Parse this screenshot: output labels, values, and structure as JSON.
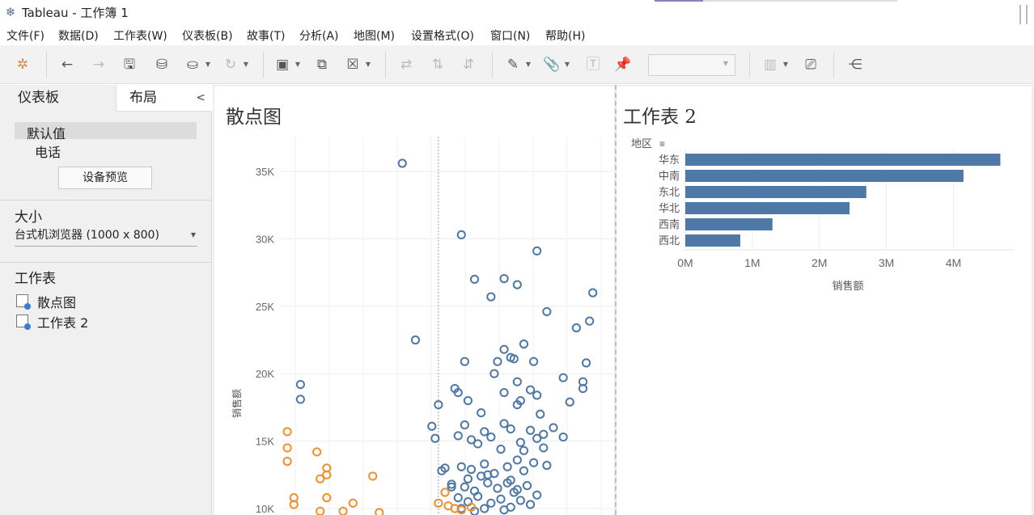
{
  "window": {
    "title": "Tableau - 工作簿 1"
  },
  "menu": [
    "文件(F)",
    "数据(D)",
    "工作表(W)",
    "仪表板(B)",
    "故事(T)",
    "分析(A)",
    "地图(M)",
    "设置格式(O)",
    "窗口(N)",
    "帮助(H)"
  ],
  "toolbar": {
    "icons": [
      "tableau-logo-icon",
      "undo-icon",
      "redo-icon",
      "save-icon",
      "new-datasource-icon",
      "pause-update-icon",
      "refresh-icon",
      "new-sheet-icon",
      "duplicate-sheet-icon",
      "clear-sheet-icon",
      "swap-icon",
      "sort-ascending-icon",
      "sort-descending-icon",
      "highlight-icon",
      "group-icon",
      "label-icon",
      "pin-icon",
      "show-cards-icon",
      "presentation-icon",
      "share-icon"
    ],
    "fit_value": ""
  },
  "left_panel": {
    "tab_dashboard": "仪表板",
    "tab_layout": "布局",
    "devices": [
      "默认值",
      "电话"
    ],
    "device_preview_button": "设备预览",
    "size_header": "大小",
    "size_value": "台式机浏览器 (1000 x 800)",
    "sheets_header": "工作表",
    "sheets": [
      "散点图",
      "工作表 2"
    ]
  },
  "dashboard": {
    "scatter_title": "散点图",
    "bar_title": "工作表 2"
  },
  "colors": {
    "blue": "#4e79a7",
    "orange": "#f28e2b"
  },
  "chart_data": [
    {
      "type": "scatter",
      "title": "散点图",
      "ylabel": "销售额",
      "yticks": [
        "35K",
        "30K",
        "25K",
        "20K",
        "15K",
        "10K"
      ],
      "ylim": [
        9500,
        37000
      ],
      "xlim": [
        0,
        1
      ],
      "reference_line_x": 0.48,
      "series": [
        {
          "name": "",
          "color": "#4e79a7",
          "points": [
            [
              0.37,
              35600
            ],
            [
              0.55,
              30300
            ],
            [
              0.78,
              29100
            ],
            [
              0.59,
              27000
            ],
            [
              0.68,
              27050
            ],
            [
              0.72,
              26600
            ],
            [
              0.64,
              25700
            ],
            [
              0.95,
              26000
            ],
            [
              0.81,
              24600
            ],
            [
              0.9,
              23400
            ],
            [
              0.94,
              23900
            ],
            [
              0.41,
              22500
            ],
            [
              0.74,
              22200
            ],
            [
              0.68,
              21800
            ],
            [
              0.7,
              21200
            ],
            [
              0.56,
              20900
            ],
            [
              0.66,
              20900
            ],
            [
              0.71,
              21100
            ],
            [
              0.77,
              20900
            ],
            [
              0.93,
              20800
            ],
            [
              0.65,
              20000
            ],
            [
              0.86,
              19700
            ],
            [
              0.92,
              19400
            ],
            [
              0.06,
              19200
            ],
            [
              0.53,
              18900
            ],
            [
              0.72,
              19400
            ],
            [
              0.92,
              18900
            ],
            [
              0.68,
              18600
            ],
            [
              0.54,
              18600
            ],
            [
              0.76,
              18800
            ],
            [
              0.78,
              18400
            ],
            [
              0.57,
              18000
            ],
            [
              0.73,
              18000
            ],
            [
              0.72,
              17700
            ],
            [
              0.48,
              17700
            ],
            [
              0.61,
              17100
            ],
            [
              0.88,
              17900
            ],
            [
              0.06,
              18100
            ],
            [
              0.79,
              17000
            ],
            [
              0.46,
              16100
            ],
            [
              0.56,
              16200
            ],
            [
              0.62,
              15700
            ],
            [
              0.68,
              16300
            ],
            [
              0.7,
              15900
            ],
            [
              0.76,
              15800
            ],
            [
              0.8,
              15500
            ],
            [
              0.83,
              16000
            ],
            [
              0.54,
              15400
            ],
            [
              0.58,
              15100
            ],
            [
              0.64,
              15300
            ],
            [
              0.73,
              14900
            ],
            [
              0.78,
              15200
            ],
            [
              0.86,
              15300
            ],
            [
              0.47,
              15200
            ],
            [
              0.6,
              14800
            ],
            [
              0.67,
              14400
            ],
            [
              0.74,
              14300
            ],
            [
              0.8,
              14500
            ],
            [
              0.5,
              13000
            ],
            [
              0.55,
              13100
            ],
            [
              0.62,
              13300
            ],
            [
              0.69,
              13100
            ],
            [
              0.72,
              13600
            ],
            [
              0.77,
              13400
            ],
            [
              0.81,
              13200
            ],
            [
              0.58,
              12900
            ],
            [
              0.61,
              12400
            ],
            [
              0.65,
              12600
            ],
            [
              0.7,
              12100
            ],
            [
              0.74,
              12800
            ],
            [
              0.52,
              11800
            ],
            [
              0.56,
              11600
            ],
            [
              0.59,
              11300
            ],
            [
              0.63,
              11900
            ],
            [
              0.66,
              11500
            ],
            [
              0.71,
              11200
            ],
            [
              0.75,
              11700
            ],
            [
              0.78,
              11000
            ],
            [
              0.54,
              10800
            ],
            [
              0.57,
              10500
            ],
            [
              0.6,
              10900
            ],
            [
              0.64,
              10400
            ],
            [
              0.67,
              10700
            ],
            [
              0.7,
              10100
            ],
            [
              0.73,
              10600
            ],
            [
              0.76,
              10300
            ],
            [
              0.55,
              10000
            ],
            [
              0.62,
              10000
            ],
            [
              0.68,
              9900
            ],
            [
              0.59,
              9800
            ],
            [
              0.49,
              12800
            ],
            [
              0.52,
              11600
            ],
            [
              0.57,
              12200
            ],
            [
              0.63,
              12500
            ],
            [
              0.69,
              11900
            ],
            [
              0.72,
              11400
            ]
          ]
        },
        {
          "name": "",
          "color": "#f28e2b",
          "points": [
            [
              0.02,
              15700
            ],
            [
              0.02,
              14500
            ],
            [
              0.02,
              13500
            ],
            [
              0.11,
              14200
            ],
            [
              0.14,
              13000
            ],
            [
              0.12,
              12200
            ],
            [
              0.14,
              12500
            ],
            [
              0.28,
              12400
            ],
            [
              0.04,
              10800
            ],
            [
              0.04,
              10300
            ],
            [
              0.14,
              10800
            ],
            [
              0.22,
              10400
            ],
            [
              0.5,
              11200
            ],
            [
              0.48,
              10400
            ],
            [
              0.51,
              10200
            ],
            [
              0.53,
              10000
            ],
            [
              0.55,
              9900
            ],
            [
              0.58,
              10100
            ],
            [
              0.12,
              9800
            ],
            [
              0.19,
              9800
            ],
            [
              0.3,
              9700
            ]
          ]
        }
      ]
    },
    {
      "type": "bar",
      "title": "工作表 2",
      "dimension_label": "地区",
      "xlabel": "销售额",
      "categories": [
        "华东",
        "中南",
        "东北",
        "华北",
        "西南",
        "西北"
      ],
      "values": [
        4700000,
        4150000,
        2700000,
        2450000,
        1300000,
        820000
      ],
      "xticks": [
        "0M",
        "1M",
        "2M",
        "3M",
        "4M"
      ],
      "xlim": [
        0,
        4900000
      ],
      "color": "#4e79a7"
    }
  ]
}
